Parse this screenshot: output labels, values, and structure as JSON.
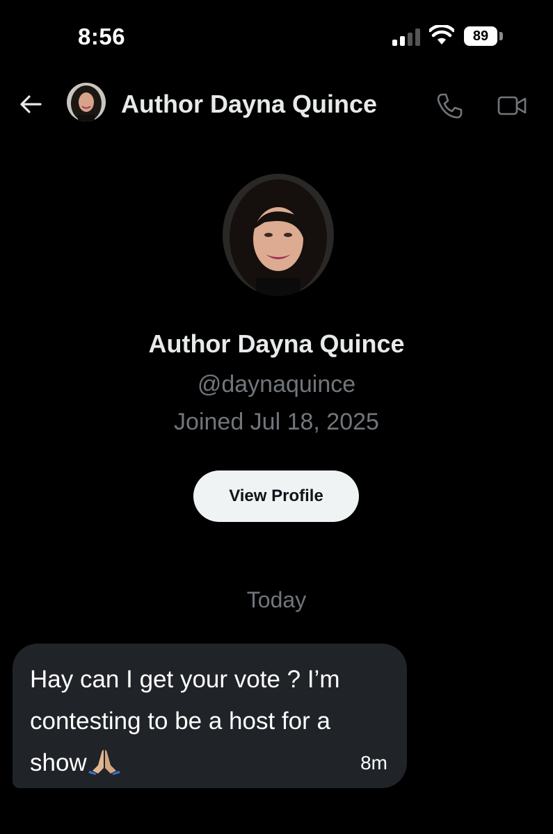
{
  "status_bar": {
    "time": "8:56",
    "battery_level": "89",
    "signal_icon": "cellular-signal-icon",
    "wifi_icon": "wifi-icon",
    "battery_icon": "battery-icon"
  },
  "header": {
    "back_icon": "arrow-left-icon",
    "name": "Author Dayna Quince",
    "avatar_icon": "avatar",
    "call_icon": "phone-icon",
    "video_icon": "video-camera-icon"
  },
  "profile": {
    "name": "Author Dayna Quince",
    "handle": "@daynaquince",
    "joined": "Joined Jul 18, 2025",
    "view_profile_label": "View Profile"
  },
  "conversation": {
    "date_separator": "Today",
    "messages": [
      {
        "text": "Hay can I get your vote ? I’m contesting to be a host for a show",
        "emoji": "folded-hands-icon",
        "time": "8m"
      }
    ]
  },
  "colors": {
    "background": "#000000",
    "primary_text": "#e7e9ea",
    "secondary_text": "#71767b",
    "bubble": "#202327",
    "button_bg": "#eff3f4",
    "button_text": "#0f1419"
  }
}
